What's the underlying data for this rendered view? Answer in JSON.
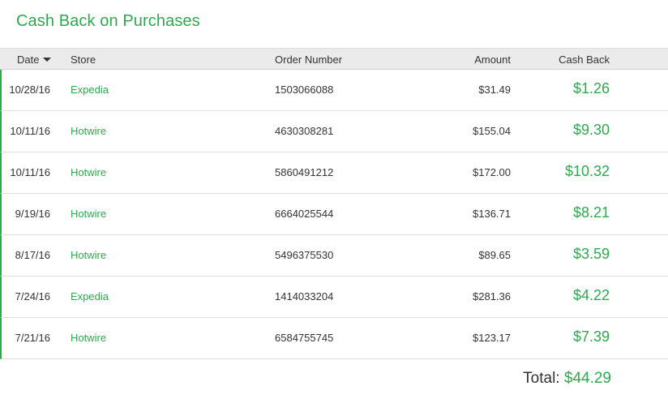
{
  "title": "Cash Back on Purchases",
  "colors": {
    "accent": "#2fa84f",
    "header_bg": "#ebebeb"
  },
  "columns": {
    "date": "Date",
    "store": "Store",
    "order_number": "Order Number",
    "amount": "Amount",
    "cash_back": "Cash Back"
  },
  "sort_icon": "caret-down-icon",
  "rows": [
    {
      "date": "10/28/16",
      "store": "Expedia",
      "order_number": "1503066088",
      "amount": "$31.49",
      "cash_back": "$1.26"
    },
    {
      "date": "10/11/16",
      "store": "Hotwire",
      "order_number": "4630308281",
      "amount": "$155.04",
      "cash_back": "$9.30"
    },
    {
      "date": "10/11/16",
      "store": "Hotwire",
      "order_number": "5860491212",
      "amount": "$172.00",
      "cash_back": "$10.32"
    },
    {
      "date": "9/19/16",
      "store": "Hotwire",
      "order_number": "6664025544",
      "amount": "$136.71",
      "cash_back": "$8.21"
    },
    {
      "date": "8/17/16",
      "store": "Hotwire",
      "order_number": "5496375530",
      "amount": "$89.65",
      "cash_back": "$3.59"
    },
    {
      "date": "7/24/16",
      "store": "Expedia",
      "order_number": "1414033204",
      "amount": "$281.36",
      "cash_back": "$4.22"
    },
    {
      "date": "7/21/16",
      "store": "Hotwire",
      "order_number": "6584755745",
      "amount": "$123.17",
      "cash_back": "$7.39"
    }
  ],
  "total": {
    "label": "Total:",
    "value": "$44.29"
  }
}
